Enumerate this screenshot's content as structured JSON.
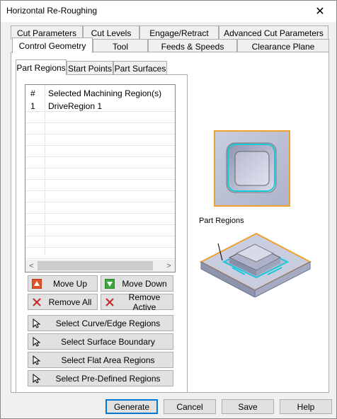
{
  "window": {
    "title": "Horizontal Re-Roughing",
    "close_glyph": "✕"
  },
  "tabs_row1": [
    "Cut Parameters",
    "Cut Levels",
    "Engage/Retract",
    "Advanced Cut Parameters"
  ],
  "tabs_row2": [
    "Control Geometry",
    "Tool",
    "Feeds & Speeds",
    "Clearance Plane"
  ],
  "active_tab": "Control Geometry",
  "inner_tabs": [
    "Part Regions",
    "Start Points",
    "Part Surfaces"
  ],
  "active_inner_tab": "Part Regions",
  "list": {
    "col_hash": "#",
    "col_name": "Selected Machining Region(s)",
    "rows": [
      {
        "num": "1",
        "name": "DriveRegion 1"
      }
    ],
    "scroll_left": "<",
    "scroll_right": ">"
  },
  "buttons": {
    "move_up": "Move Up",
    "move_down": "Move Down",
    "remove_all": "Remove All",
    "remove_active": "Remove Active",
    "select_curve": "Select Curve/Edge Regions",
    "select_surface": "Select Surface Boundary",
    "select_flat": "Select Flat Area Regions",
    "select_predefined": "Select Pre-Defined Regions"
  },
  "preview": {
    "label": "Part Regions"
  },
  "dialog_buttons": {
    "generate": "Generate",
    "cancel": "Cancel",
    "save": "Save",
    "help": "Help"
  },
  "colors": {
    "accent_blue": "#0078d7",
    "region_orange": "#f0a030",
    "region_cyan": "#19c8d8",
    "up_red": "#e2522a",
    "down_green": "#3ca53c"
  }
}
